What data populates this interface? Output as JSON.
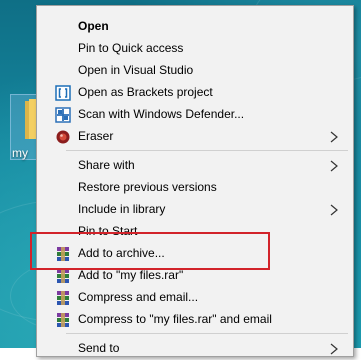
{
  "desktop": {
    "icon_label": "my",
    "icon_name": "folder-icon"
  },
  "context_menu": {
    "items": [
      {
        "label": "Open",
        "icon": null,
        "submenu": false,
        "bold": true
      },
      {
        "label": "Pin to Quick access",
        "icon": null,
        "submenu": false
      },
      {
        "label": "Open in Visual Studio",
        "icon": null,
        "submenu": false
      },
      {
        "label": "Open as Brackets project",
        "icon": "brackets-icon",
        "submenu": false
      },
      {
        "label": "Scan with Windows Defender...",
        "icon": "windows-defender-icon",
        "submenu": false
      },
      {
        "label": "Eraser",
        "icon": "eraser-icon",
        "submenu": true
      },
      {
        "label": "Share with",
        "icon": null,
        "submenu": true
      },
      {
        "label": "Restore previous versions",
        "icon": null,
        "submenu": false
      },
      {
        "label": "Include in library",
        "icon": null,
        "submenu": true
      },
      {
        "label": "Pin to Start",
        "icon": null,
        "submenu": false
      },
      {
        "label": "Add to archive...",
        "icon": "winrar-icon",
        "submenu": false
      },
      {
        "label": "Add to \"my files.rar\"",
        "icon": "winrar-icon",
        "submenu": false
      },
      {
        "label": "Compress and email...",
        "icon": "winrar-icon",
        "submenu": false
      },
      {
        "label": "Compress to \"my files.rar\" and email",
        "icon": "winrar-icon",
        "submenu": false
      },
      {
        "label": "Send to",
        "icon": null,
        "submenu": true
      }
    ]
  },
  "annotation": {
    "highlighted_item": "Add to archive...",
    "color": "#d2232a"
  }
}
